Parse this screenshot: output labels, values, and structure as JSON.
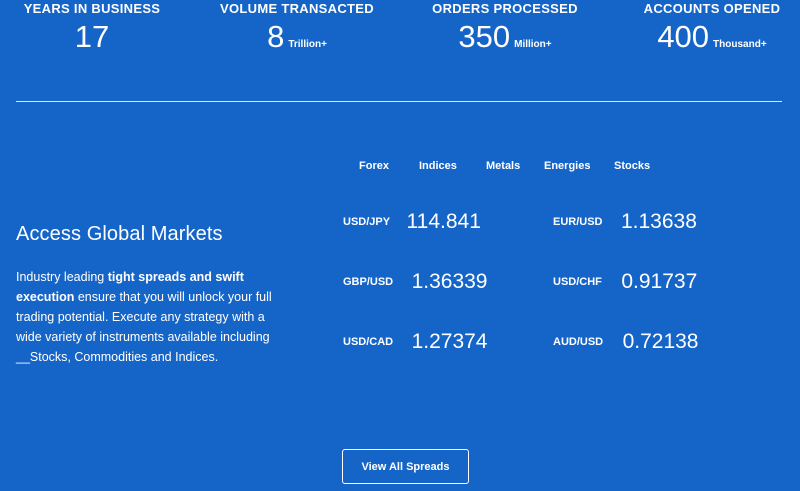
{
  "stats": [
    {
      "label": "YEARS IN BUSINESS",
      "value": "17",
      "unit": ""
    },
    {
      "label": "VOLUME TRANSACTED",
      "value": "8",
      "unit": "Trillion+"
    },
    {
      "label": "ORDERS PROCESSED",
      "value": "350",
      "unit": "Million+"
    },
    {
      "label": "ACCOUNTS OPENED",
      "value": "400",
      "unit": "Thousand+"
    }
  ],
  "markets": {
    "heading": "Access Global Markets",
    "desc_1": "Industry leading ",
    "desc_bold": "tight spreads and swift execution",
    "desc_2": " ensure that you will unlock your full trading potential. Execute any strategy with a wide variety of instruments available including __Stocks, Commodities and Indices."
  },
  "tabs": [
    "Forex",
    "Indices",
    "Metals",
    "Energies",
    "Stocks"
  ],
  "quotes": [
    {
      "pair": "USD/JPY",
      "price": "114.841"
    },
    {
      "pair": "EUR/USD",
      "price": "1.13638"
    },
    {
      "pair": "GBP/USD",
      "price": "1.36339"
    },
    {
      "pair": "USD/CHF",
      "price": "0.91737"
    },
    {
      "pair": "USD/CAD",
      "price": "1.27374"
    },
    {
      "pair": "AUD/USD",
      "price": "0.72138"
    }
  ],
  "button": {
    "label": "View All Spreads"
  },
  "colors": {
    "background": "#1565c8",
    "text": "#ffffff"
  }
}
